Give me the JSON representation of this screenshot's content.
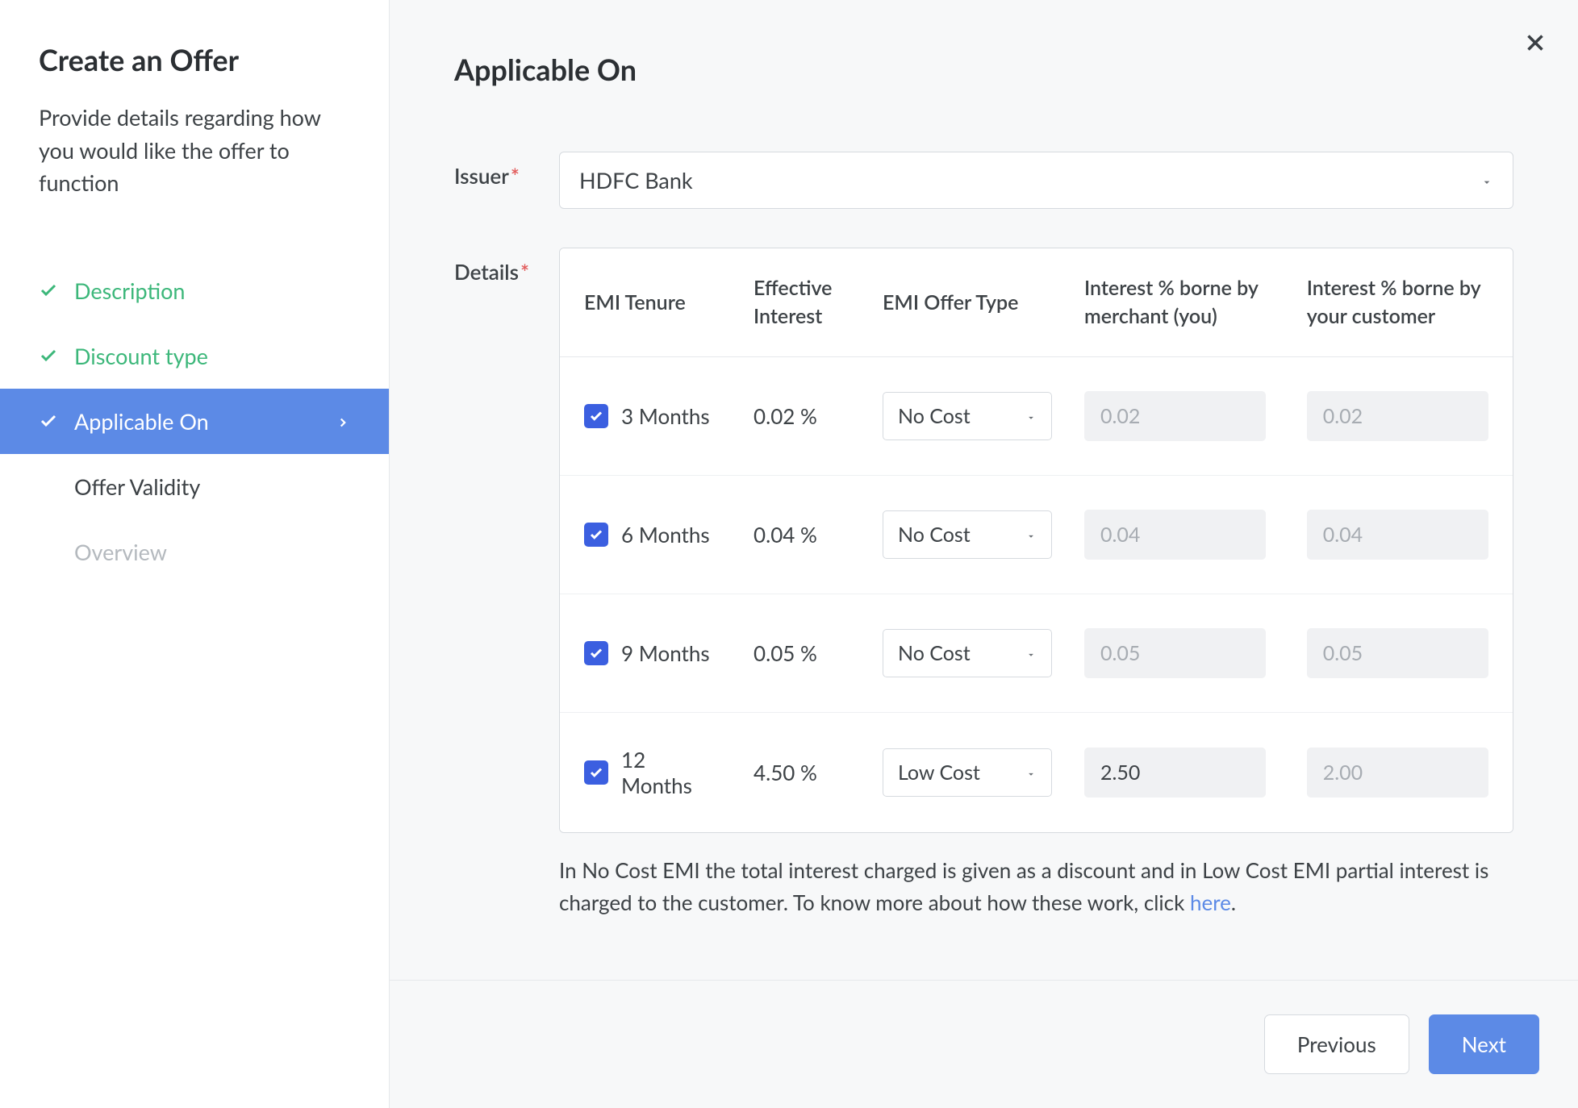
{
  "sidebar": {
    "title": "Create an Offer",
    "description": "Provide details regarding how you would like the offer to function",
    "nav": [
      {
        "label": "Description"
      },
      {
        "label": "Discount type"
      },
      {
        "label": "Applicable On"
      },
      {
        "label": "Offer Validity"
      },
      {
        "label": "Overview"
      }
    ]
  },
  "main": {
    "title": "Applicable On",
    "issuer_label": "Issuer",
    "issuer_value": "HDFC Bank",
    "details_label": "Details",
    "table": {
      "headers": {
        "tenure": "EMI Tenure",
        "effective": "Effective Interest",
        "offer_type": "EMI Offer Type",
        "merchant": "Interest % borne by merchant (you)",
        "customer": "Interest % borne by your customer"
      },
      "rows": [
        {
          "tenure": "3 Months",
          "effective": "0.02 %",
          "offer_type": "No Cost",
          "merchant": "0.02",
          "customer": "0.02",
          "readonly": true
        },
        {
          "tenure": "6 Months",
          "effective": "0.04 %",
          "offer_type": "No Cost",
          "merchant": "0.04",
          "customer": "0.04",
          "readonly": true
        },
        {
          "tenure": "9 Months",
          "effective": "0.05 %",
          "offer_type": "No Cost",
          "merchant": "0.05",
          "customer": "0.05",
          "readonly": true
        },
        {
          "tenure": "12 Months",
          "effective": "4.50 %",
          "offer_type": "Low Cost",
          "merchant": "2.50",
          "customer": "2.00",
          "readonly": false
        }
      ]
    },
    "help_prefix": "In No Cost EMI the total interest charged is given as a discount and in Low Cost EMI partial interest is charged to the customer. To know more about how these work, click ",
    "help_link": "here",
    "help_suffix": "."
  },
  "footer": {
    "previous": "Previous",
    "next": "Next"
  }
}
